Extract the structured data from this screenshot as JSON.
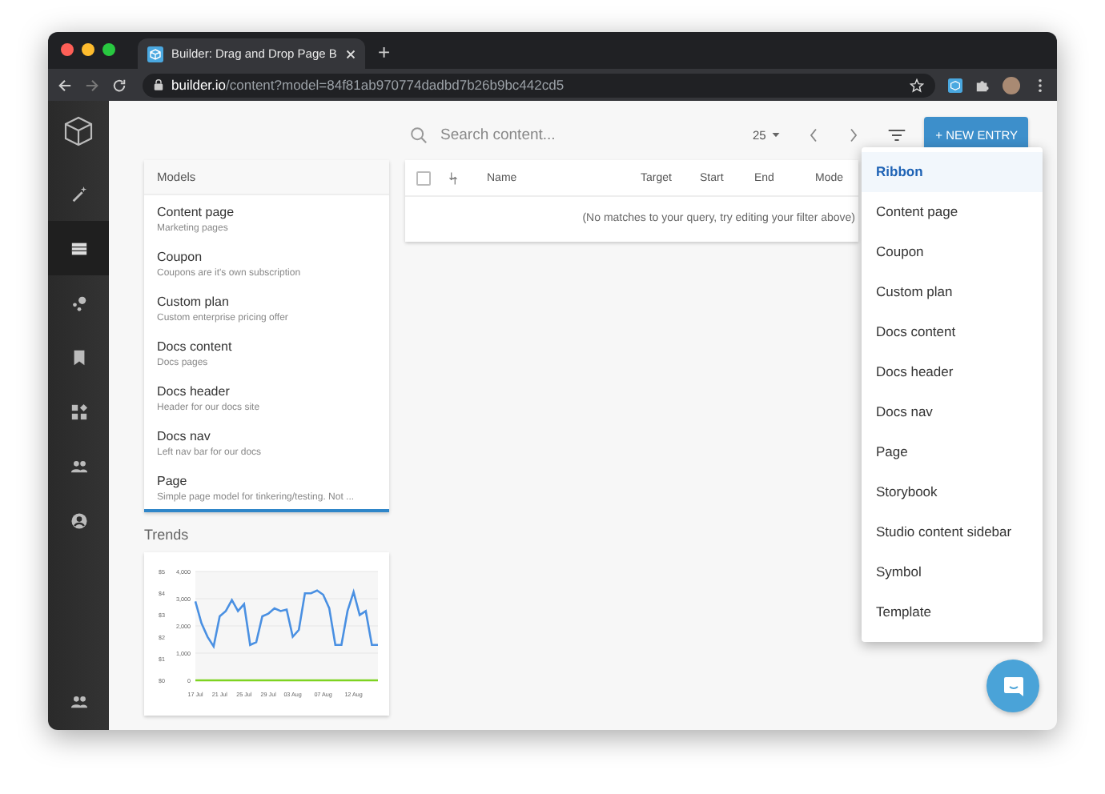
{
  "browser": {
    "tab_title": "Builder: Drag and Drop Page B",
    "new_tab": "+",
    "url_host": "builder.io",
    "url_path": "/content?model=84f81ab970774dadbd7b26b9bc442cd5"
  },
  "sidebar": {
    "items": [
      {
        "selected": false
      },
      {
        "selected": true
      },
      {
        "selected": false
      },
      {
        "selected": false
      },
      {
        "selected": false
      },
      {
        "selected": false
      },
      {
        "selected": false
      }
    ]
  },
  "toolbar": {
    "search_placeholder": "Search content...",
    "page_size": "25",
    "new_entry": "+ NEW ENTRY"
  },
  "models": {
    "title": "Models",
    "items": [
      {
        "name": "Content page",
        "description": "Marketing pages"
      },
      {
        "name": "Coupon",
        "description": "Coupons are it's own subscription"
      },
      {
        "name": "Custom plan",
        "description": "Custom enterprise pricing offer"
      },
      {
        "name": "Docs content",
        "description": "Docs pages"
      },
      {
        "name": "Docs header",
        "description": "Header for our docs site"
      },
      {
        "name": "Docs nav",
        "description": "Left nav bar for our docs"
      },
      {
        "name": "Page",
        "description": "Simple page model for tinkering/testing. Not ..."
      }
    ]
  },
  "table": {
    "select_all_checked": false,
    "columns": [
      "Name",
      "Target",
      "Start",
      "End",
      "Mode"
    ],
    "empty_message": "(No matches to your query, try editing your filter above)"
  },
  "trends": {
    "title": "Trends",
    "left_axis_labels": [
      "$5",
      "$4",
      "$3",
      "$2",
      "$1",
      "$0"
    ],
    "chart_data": {
      "type": "line",
      "grid": true,
      "categories": [
        "17 Jul",
        null,
        null,
        null,
        "21 Jul",
        null,
        null,
        null,
        "25 Jul",
        null,
        null,
        null,
        "29 Jul",
        null,
        null,
        null,
        "03 Aug",
        null,
        null,
        null,
        null,
        "07 Aug",
        null,
        null,
        null,
        null,
        "12 Aug",
        null,
        null,
        null,
        null
      ],
      "ylim": [
        0,
        4000
      ],
      "yticks": [
        {
          "value": 0,
          "label": "0"
        },
        {
          "value": 1000,
          "label": "1,000"
        },
        {
          "value": 2000,
          "label": "2,000"
        },
        {
          "value": 3000,
          "label": "3,000"
        },
        {
          "value": 4000,
          "label": "4,000"
        }
      ],
      "series": [
        {
          "color": "#4a90e2",
          "values": [
            2900,
            2100,
            1600,
            1250,
            2350,
            2550,
            2950,
            2550,
            2800,
            1300,
            1400,
            2350,
            2450,
            2650,
            2550,
            2600,
            1600,
            1850,
            3200,
            3200,
            3300,
            3150,
            2650,
            1300,
            1300,
            2550,
            3250,
            2400,
            2550,
            1300,
            1300
          ]
        },
        {
          "color": "#7ed321",
          "values": [
            0,
            0,
            0,
            0,
            0,
            0,
            0,
            0,
            0,
            0,
            0,
            0,
            0,
            0,
            0,
            0,
            0,
            0,
            0,
            0,
            0,
            0,
            0,
            0,
            0,
            0,
            0,
            0,
            0,
            0,
            0
          ]
        }
      ]
    }
  },
  "menu": {
    "items": [
      {
        "label": "Ribbon",
        "selected": true
      },
      {
        "label": "Content page",
        "selected": false
      },
      {
        "label": "Coupon",
        "selected": false
      },
      {
        "label": "Custom plan",
        "selected": false
      },
      {
        "label": "Docs content",
        "selected": false
      },
      {
        "label": "Docs header",
        "selected": false
      },
      {
        "label": "Docs nav",
        "selected": false
      },
      {
        "label": "Page",
        "selected": false
      },
      {
        "label": "Storybook",
        "selected": false
      },
      {
        "label": "Studio content sidebar",
        "selected": false
      },
      {
        "label": "Symbol",
        "selected": false
      },
      {
        "label": "Template",
        "selected": false
      }
    ]
  }
}
